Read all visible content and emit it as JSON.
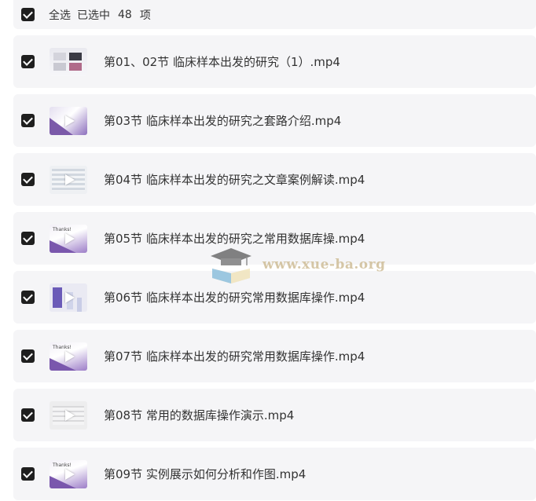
{
  "header": {
    "select_all_label": "全选",
    "selected_prefix": "已选中",
    "selected_count": "48",
    "selected_suffix": "项"
  },
  "files": [
    {
      "name": "第01、02节 临床样本出发的研究（1）.mp4",
      "thumb_style": "slides",
      "has_play": false
    },
    {
      "name": "第03节 临床样本出发的研究之套路介绍.mp4",
      "thumb_style": "purple",
      "has_play": true
    },
    {
      "name": "第04节 临床样本出发的研究之文章案例解读.mp4",
      "thumb_style": "table",
      "has_play": true
    },
    {
      "name": "第05节 临床样本出发的研究之常用数据库操.mp4",
      "thumb_style": "thanks",
      "has_play": true
    },
    {
      "name": "第06节 临床样本出发的研究常用数据库操作.mp4",
      "thumb_style": "blue",
      "has_play": true
    },
    {
      "name": "第07节 临床样本出发的研究常用数据库操作.mp4",
      "thumb_style": "thanks",
      "has_play": true
    },
    {
      "name": "第08节 常用的数据库操作演示.mp4",
      "thumb_style": "gray",
      "has_play": true
    },
    {
      "name": "第09节 实例展示如何分析和作图.mp4",
      "thumb_style": "thanks",
      "has_play": true
    }
  ],
  "watermark": {
    "text": "www.xue-ba.org"
  },
  "colors": {
    "row_background": "#f5f5f7",
    "checkbox": "#1f1f1f",
    "text": "#333333",
    "watermark_text": "#c9b58a"
  },
  "icons": {
    "checkbox": "checkbox-checked-icon",
    "play": "play-icon",
    "watermark_logo": "graduation-cap-book-logo"
  }
}
